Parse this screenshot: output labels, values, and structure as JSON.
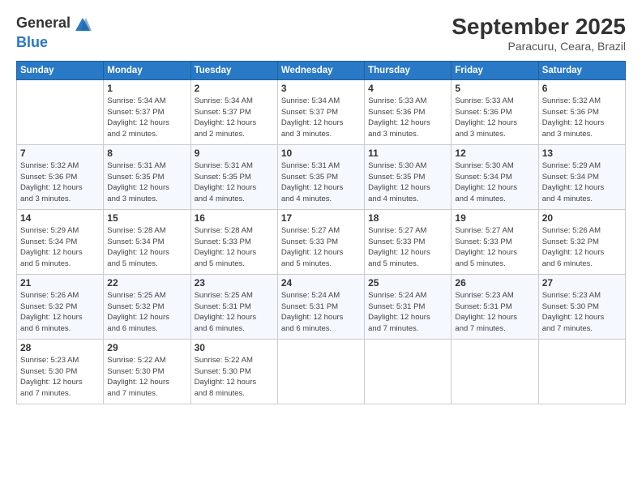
{
  "logo": {
    "general": "General",
    "blue": "Blue"
  },
  "header": {
    "month": "September 2025",
    "location": "Paracuru, Ceara, Brazil"
  },
  "weekdays": [
    "Sunday",
    "Monday",
    "Tuesday",
    "Wednesday",
    "Thursday",
    "Friday",
    "Saturday"
  ],
  "weeks": [
    [
      {
        "date": "",
        "info": ""
      },
      {
        "date": "1",
        "info": "Sunrise: 5:34 AM\nSunset: 5:37 PM\nDaylight: 12 hours\nand 2 minutes."
      },
      {
        "date": "2",
        "info": "Sunrise: 5:34 AM\nSunset: 5:37 PM\nDaylight: 12 hours\nand 2 minutes."
      },
      {
        "date": "3",
        "info": "Sunrise: 5:34 AM\nSunset: 5:37 PM\nDaylight: 12 hours\nand 3 minutes."
      },
      {
        "date": "4",
        "info": "Sunrise: 5:33 AM\nSunset: 5:36 PM\nDaylight: 12 hours\nand 3 minutes."
      },
      {
        "date": "5",
        "info": "Sunrise: 5:33 AM\nSunset: 5:36 PM\nDaylight: 12 hours\nand 3 minutes."
      },
      {
        "date": "6",
        "info": "Sunrise: 5:32 AM\nSunset: 5:36 PM\nDaylight: 12 hours\nand 3 minutes."
      }
    ],
    [
      {
        "date": "7",
        "info": "Sunrise: 5:32 AM\nSunset: 5:36 PM\nDaylight: 12 hours\nand 3 minutes."
      },
      {
        "date": "8",
        "info": "Sunrise: 5:31 AM\nSunset: 5:35 PM\nDaylight: 12 hours\nand 3 minutes."
      },
      {
        "date": "9",
        "info": "Sunrise: 5:31 AM\nSunset: 5:35 PM\nDaylight: 12 hours\nand 4 minutes."
      },
      {
        "date": "10",
        "info": "Sunrise: 5:31 AM\nSunset: 5:35 PM\nDaylight: 12 hours\nand 4 minutes."
      },
      {
        "date": "11",
        "info": "Sunrise: 5:30 AM\nSunset: 5:35 PM\nDaylight: 12 hours\nand 4 minutes."
      },
      {
        "date": "12",
        "info": "Sunrise: 5:30 AM\nSunset: 5:34 PM\nDaylight: 12 hours\nand 4 minutes."
      },
      {
        "date": "13",
        "info": "Sunrise: 5:29 AM\nSunset: 5:34 PM\nDaylight: 12 hours\nand 4 minutes."
      }
    ],
    [
      {
        "date": "14",
        "info": "Sunrise: 5:29 AM\nSunset: 5:34 PM\nDaylight: 12 hours\nand 5 minutes."
      },
      {
        "date": "15",
        "info": "Sunrise: 5:28 AM\nSunset: 5:34 PM\nDaylight: 12 hours\nand 5 minutes."
      },
      {
        "date": "16",
        "info": "Sunrise: 5:28 AM\nSunset: 5:33 PM\nDaylight: 12 hours\nand 5 minutes."
      },
      {
        "date": "17",
        "info": "Sunrise: 5:27 AM\nSunset: 5:33 PM\nDaylight: 12 hours\nand 5 minutes."
      },
      {
        "date": "18",
        "info": "Sunrise: 5:27 AM\nSunset: 5:33 PM\nDaylight: 12 hours\nand 5 minutes."
      },
      {
        "date": "19",
        "info": "Sunrise: 5:27 AM\nSunset: 5:33 PM\nDaylight: 12 hours\nand 5 minutes."
      },
      {
        "date": "20",
        "info": "Sunrise: 5:26 AM\nSunset: 5:32 PM\nDaylight: 12 hours\nand 6 minutes."
      }
    ],
    [
      {
        "date": "21",
        "info": "Sunrise: 5:26 AM\nSunset: 5:32 PM\nDaylight: 12 hours\nand 6 minutes."
      },
      {
        "date": "22",
        "info": "Sunrise: 5:25 AM\nSunset: 5:32 PM\nDaylight: 12 hours\nand 6 minutes."
      },
      {
        "date": "23",
        "info": "Sunrise: 5:25 AM\nSunset: 5:31 PM\nDaylight: 12 hours\nand 6 minutes."
      },
      {
        "date": "24",
        "info": "Sunrise: 5:24 AM\nSunset: 5:31 PM\nDaylight: 12 hours\nand 6 minutes."
      },
      {
        "date": "25",
        "info": "Sunrise: 5:24 AM\nSunset: 5:31 PM\nDaylight: 12 hours\nand 7 minutes."
      },
      {
        "date": "26",
        "info": "Sunrise: 5:23 AM\nSunset: 5:31 PM\nDaylight: 12 hours\nand 7 minutes."
      },
      {
        "date": "27",
        "info": "Sunrise: 5:23 AM\nSunset: 5:30 PM\nDaylight: 12 hours\nand 7 minutes."
      }
    ],
    [
      {
        "date": "28",
        "info": "Sunrise: 5:23 AM\nSunset: 5:30 PM\nDaylight: 12 hours\nand 7 minutes."
      },
      {
        "date": "29",
        "info": "Sunrise: 5:22 AM\nSunset: 5:30 PM\nDaylight: 12 hours\nand 7 minutes."
      },
      {
        "date": "30",
        "info": "Sunrise: 5:22 AM\nSunset: 5:30 PM\nDaylight: 12 hours\nand 8 minutes."
      },
      {
        "date": "",
        "info": ""
      },
      {
        "date": "",
        "info": ""
      },
      {
        "date": "",
        "info": ""
      },
      {
        "date": "",
        "info": ""
      }
    ]
  ]
}
